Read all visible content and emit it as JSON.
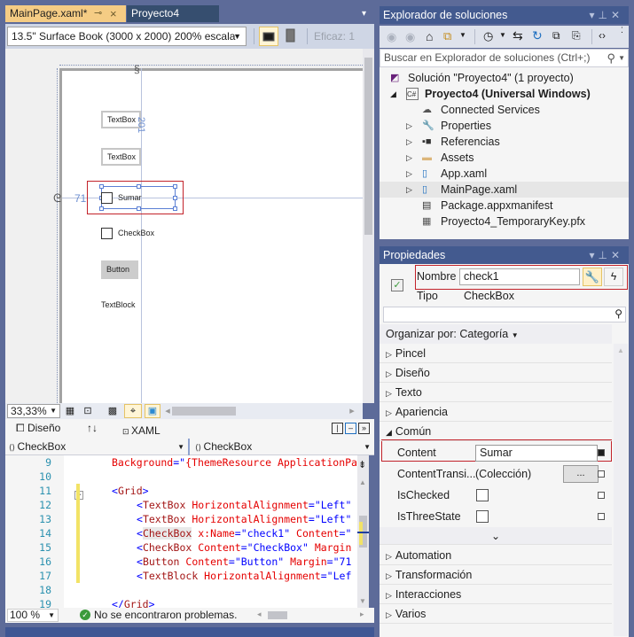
{
  "document_well": {
    "tabs": [
      {
        "label": "MainPage.xaml*",
        "active": true,
        "pin_icon": "pin",
        "close_icon": "×"
      },
      {
        "label": "Proyecto4",
        "active": false
      }
    ],
    "dropdown_icon": "▾"
  },
  "designer": {
    "device_select": "13.5\" Surface Book (3000 x 2000) 200% escala",
    "effective_label": "Eficaz: 1",
    "canvas": {
      "controls": [
        {
          "type": "TextBox",
          "text": "TextBox"
        },
        {
          "type": "TextBox",
          "text": "TextBox"
        },
        {
          "type": "CheckBox",
          "text": "Sumar",
          "selected": true
        },
        {
          "type": "CheckBox",
          "text": "CheckBox"
        },
        {
          "type": "Button",
          "text": "Button"
        },
        {
          "type": "TextBlock",
          "text": "TextBlock"
        }
      ],
      "margin_top_readout": "201",
      "margin_left_readout": "71"
    },
    "zoom_select": "33,33%",
    "zoom_icons": [
      "grid-icon",
      "snap-grid-icon",
      "checkerboard-icon",
      "snap-lines-icon",
      "project-code-icon"
    ]
  },
  "split": {
    "design_tab": "Diseño",
    "swap_icon": "↑↓",
    "xaml_tab": "XAML",
    "layout_icons": [
      "vertical-split-icon",
      "horizontal-split-icon",
      "collapse-pane-icon"
    ]
  },
  "code_nav": {
    "left": "CheckBox",
    "right": "CheckBox"
  },
  "code": {
    "lines": [
      {
        "n": "9",
        "indent": 1,
        "parts": [
          {
            "c": "attr",
            "t": "Background"
          },
          {
            "c": "br",
            "t": "=\""
          },
          {
            "c": "attr",
            "t": "{ThemeResource ApplicationPa"
          }
        ],
        "changed": false
      },
      {
        "n": "10",
        "indent": 0,
        "parts": [],
        "changed": false
      },
      {
        "n": "11",
        "indent": 1,
        "parts": [
          {
            "c": "br",
            "t": "<"
          },
          {
            "c": "tag",
            "t": "Grid"
          },
          {
            "c": "br",
            "t": ">"
          }
        ],
        "changed": true
      },
      {
        "n": "12",
        "indent": 2,
        "parts": [
          {
            "c": "br",
            "t": "<"
          },
          {
            "c": "tag",
            "t": "TextBox"
          },
          {
            "c": "attr",
            "t": " HorizontalAlignment"
          },
          {
            "c": "br",
            "t": "="
          },
          {
            "c": "val",
            "t": "\"Left\""
          }
        ],
        "changed": true
      },
      {
        "n": "13",
        "indent": 2,
        "parts": [
          {
            "c": "br",
            "t": "<"
          },
          {
            "c": "tag",
            "t": "TextBox"
          },
          {
            "c": "attr",
            "t": " HorizontalAlignment"
          },
          {
            "c": "br",
            "t": "="
          },
          {
            "c": "val",
            "t": "\"Left\""
          }
        ],
        "changed": true
      },
      {
        "n": "14",
        "indent": 2,
        "parts": [
          {
            "c": "br",
            "t": "<"
          },
          {
            "c": "tag",
            "t": "CheckBox"
          },
          {
            "c": "attr",
            "t": " x:Name"
          },
          {
            "c": "br",
            "t": "="
          },
          {
            "c": "val",
            "t": "\"check1\""
          },
          {
            "c": "attr",
            "t": " Content"
          },
          {
            "c": "br",
            "t": "=\""
          }
        ],
        "changed": true
      },
      {
        "n": "15",
        "indent": 2,
        "parts": [
          {
            "c": "br",
            "t": "<"
          },
          {
            "c": "tag",
            "t": "CheckBox"
          },
          {
            "c": "attr",
            "t": " Content"
          },
          {
            "c": "br",
            "t": "="
          },
          {
            "c": "val",
            "t": "\"CheckBox\""
          },
          {
            "c": "attr",
            "t": " Margin"
          }
        ],
        "changed": true
      },
      {
        "n": "16",
        "indent": 2,
        "parts": [
          {
            "c": "br",
            "t": "<"
          },
          {
            "c": "tag",
            "t": "Button"
          },
          {
            "c": "attr",
            "t": " Content"
          },
          {
            "c": "br",
            "t": "="
          },
          {
            "c": "val",
            "t": "\"Button\""
          },
          {
            "c": "attr",
            "t": " Margin"
          },
          {
            "c": "br",
            "t": "="
          },
          {
            "c": "val",
            "t": "\"71"
          }
        ],
        "changed": true
      },
      {
        "n": "17",
        "indent": 2,
        "parts": [
          {
            "c": "br",
            "t": "<"
          },
          {
            "c": "tag",
            "t": "TextBlock"
          },
          {
            "c": "attr",
            "t": " HorizontalAlignment"
          },
          {
            "c": "br",
            "t": "="
          },
          {
            "c": "val",
            "t": "\"Lef"
          }
        ],
        "changed": true
      },
      {
        "n": "18",
        "indent": 0,
        "parts": [],
        "changed": false
      },
      {
        "n": "19",
        "indent": 1,
        "parts": [
          {
            "c": "br",
            "t": "</"
          },
          {
            "c": "tag",
            "t": "Grid"
          },
          {
            "c": "br",
            "t": ">"
          }
        ],
        "changed": false
      }
    ]
  },
  "status": {
    "zoom": "100 %",
    "message": "No se encontraron problemas."
  },
  "solution_explorer": {
    "title": "Explorador de soluciones",
    "search_placeholder": "Buscar en Explorador de soluciones (Ctrl+;)",
    "tree": [
      {
        "label": "Solución \"Proyecto4\"  (1 proyecto)",
        "level": 0,
        "expander": "",
        "icon": "solution-icon"
      },
      {
        "label": "Proyecto4 (Universal Windows)",
        "level": 1,
        "expander": "◢",
        "icon": "csharp-project-icon",
        "bold": true
      },
      {
        "label": "Connected Services",
        "level": 2,
        "expander": "",
        "icon": "cloud-icon"
      },
      {
        "label": "Properties",
        "level": 2,
        "expander": "▷",
        "icon": "wrench-icon"
      },
      {
        "label": "Referencias",
        "level": 2,
        "expander": "▷",
        "icon": "references-icon"
      },
      {
        "label": "Assets",
        "level": 2,
        "expander": "▷",
        "icon": "folder-icon"
      },
      {
        "label": "App.xaml",
        "level": 2,
        "expander": "▷",
        "icon": "xaml-file-icon"
      },
      {
        "label": "MainPage.xaml",
        "level": 2,
        "expander": "▷",
        "icon": "xaml-file-icon",
        "selected": true
      },
      {
        "label": "Package.appxmanifest",
        "level": 2,
        "expander": "",
        "icon": "manifest-icon"
      },
      {
        "label": "Proyecto4_TemporaryKey.pfx",
        "level": 2,
        "expander": "",
        "icon": "certificate-icon"
      }
    ]
  },
  "properties": {
    "title": "Propiedades",
    "name_label": "Nombre",
    "name_value": "check1",
    "type_label": "Tipo",
    "type_value": "CheckBox",
    "arrange_label": "Organizar por: Categoría",
    "categories_before": [
      "Pincel",
      "Diseño",
      "Texto",
      "Apariencia"
    ],
    "expanded_category": "Común",
    "common_props": [
      {
        "name": "Content",
        "value": "Sumar",
        "kind": "text",
        "set": true
      },
      {
        "name": "ContentTransi...",
        "value": "(Colección)",
        "kind": "collection",
        "button": "...",
        "set": false
      },
      {
        "name": "IsChecked",
        "value": false,
        "kind": "checkbox",
        "set": false
      },
      {
        "name": "IsThreeState",
        "value": false,
        "kind": "checkbox",
        "set": false
      }
    ],
    "categories_after": [
      "Automation",
      "Transformación",
      "Interacciones",
      "Varios"
    ]
  },
  "colors": {
    "accent_tab": "#f5cc84",
    "panel_title": "#435a8f",
    "highlight_red": "#c2222a",
    "selection_blue": "#5b7fd4"
  }
}
